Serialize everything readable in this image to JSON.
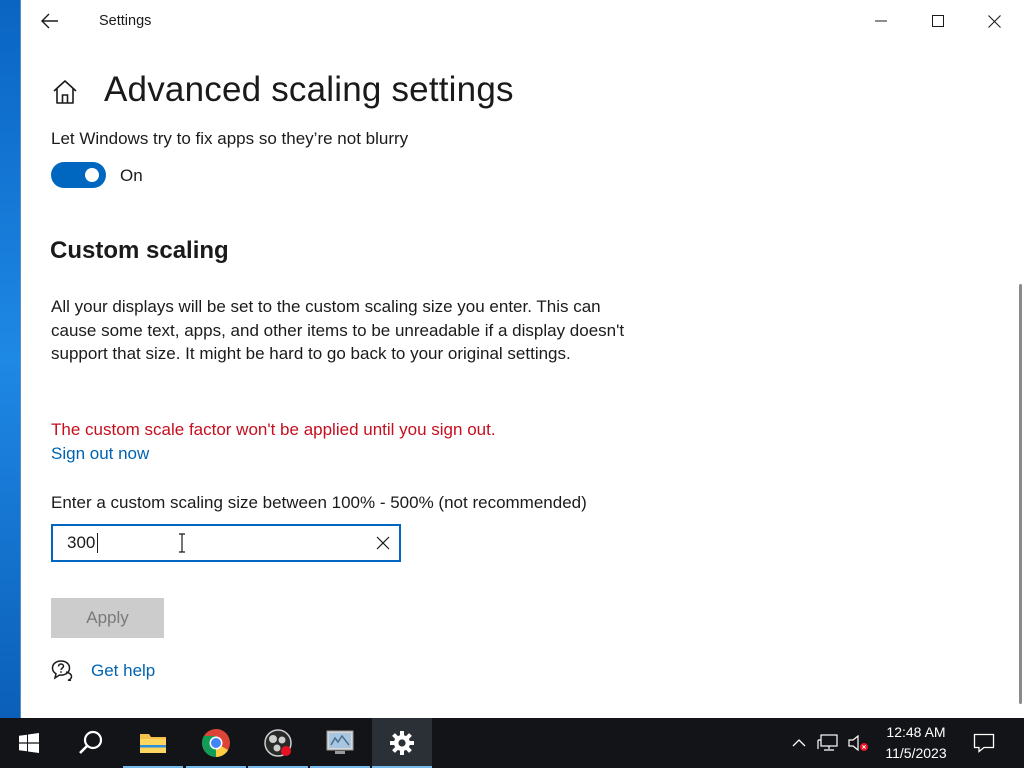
{
  "window": {
    "title": "Settings"
  },
  "page": {
    "title": "Advanced scaling settings",
    "blurry_label": "Let Windows try to fix apps so they’re not blurry",
    "toggle_state": "On",
    "section_title": "Custom scaling",
    "description": "All your displays will be set to the custom scaling size you enter. This can cause some text, apps, and other items to be unreadable if a display doesn't support that size. It might be hard to go back to your original settings.",
    "warning": "The custom scale factor won't be applied until you sign out.",
    "signout_link": "Sign out now",
    "input_label": "Enter a custom scaling size between 100% - 500% (not recommended)",
    "input_value": "300",
    "apply_label": "Apply",
    "help_label": "Get help"
  },
  "taskbar": {
    "items": [
      "start-icon",
      "search-icon",
      "file-explorer-icon",
      "chrome-icon",
      "obs-icon",
      "remote-desktop-icon",
      "settings-icon"
    ],
    "active": "settings-icon",
    "tray": [
      "chevron-up-icon",
      "network-icon",
      "volume-muted-icon"
    ],
    "time": "12:48 AM",
    "date": "11/5/2023"
  },
  "colors": {
    "accent": "#0067c0",
    "link": "#0063b1",
    "warning": "#c50f1f",
    "taskbar": "#121417"
  }
}
